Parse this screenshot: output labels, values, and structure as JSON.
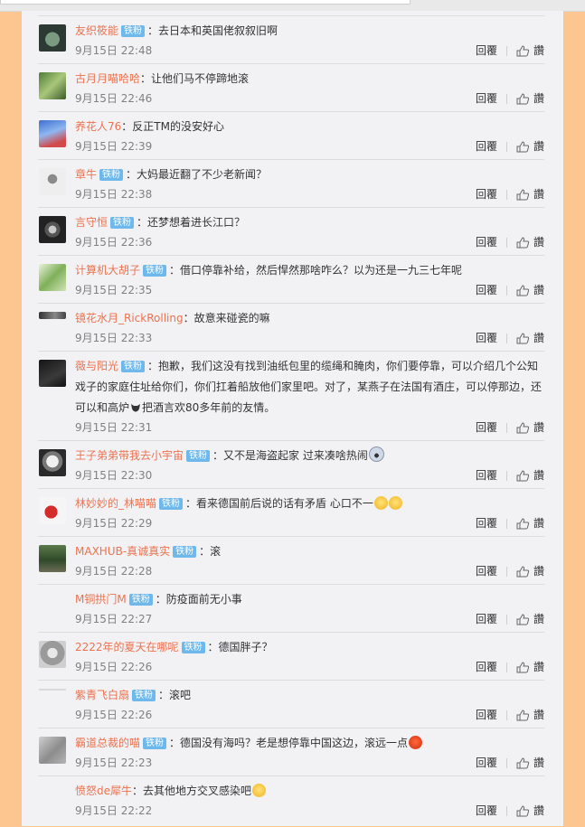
{
  "colors": {
    "background": "#fdc590",
    "panel": "#f2f2f5",
    "username": "#eb7350",
    "badge": "#6fb8ec",
    "time": "#808080"
  },
  "actions": {
    "reply_label": "回覆",
    "like_label": "讚"
  },
  "comments": [
    {
      "user": "友织筱能",
      "badge": "铁粉",
      "text": "：去日本和英国佬叙叙旧啊",
      "time": "9月15日 22:48"
    },
    {
      "user": "古月月喵哈哈",
      "badge": "",
      "text": "：让他们马不停蹄地滚",
      "time": "9月15日 22:46"
    },
    {
      "user": "养花人76",
      "badge": "",
      "text": "：反正TM的没安好心",
      "time": "9月15日 22:39"
    },
    {
      "user": "章牛",
      "badge": "铁粉",
      "text": "：大妈最近翻了不少老新闻？",
      "time": "9月15日 22:38"
    },
    {
      "user": "言守恒",
      "badge": "铁粉",
      "text": "：还梦想着进长江口？",
      "time": "9月15日 22:36"
    },
    {
      "user": "计算机大胡子",
      "badge": "铁粉",
      "text": "：借口停靠补给，然后悍然那啥咋么？以为还是一九三七年呢",
      "time": "9月15日 22:35"
    },
    {
      "user": "镜花水月_RickRolling",
      "badge": "",
      "text": "：故意来碰瓷的嘛",
      "time": "9月15日 22:33"
    },
    {
      "user": "薇与阳光",
      "badge": "铁粉",
      "text": "：抱歉，我们这没有找到油纸包里的缆绳和腌肉，你们要停靠，可以介绍几个公知戏子的家庭住址给你们，你们扛着船放他们家里吧。对了，某燕子在法国有酒庄，可以停那边，还可以和高炉",
      "text2": "把酒言欢80多年前的友情。",
      "time": "9月15日 22:31"
    },
    {
      "user": "王子弟弟带我去小宇宙",
      "badge": "铁粉",
      "text": "：又不是海盗起家 过来凑啥热闹",
      "time": "9月15日 22:30"
    },
    {
      "user": "林妙妙的_林喵喵",
      "badge": "铁粉",
      "text": "：看来德国前后说的话有矛盾 心口不一",
      "time": "9月15日 22:29"
    },
    {
      "user": "MAXHUB-真诚真实",
      "badge": "铁粉",
      "text": "：滚",
      "time": "9月15日 22:28"
    },
    {
      "user": "M铜拱门M",
      "badge": "铁粉",
      "text": "：防疫面前无小事",
      "time": "9月15日 22:27"
    },
    {
      "user": "2222年的夏天在哪呢",
      "badge": "铁粉",
      "text": "：德国胖子？",
      "time": "9月15日 22:26"
    },
    {
      "user": "紫青飞白扇",
      "badge": "铁粉",
      "text": "：滚吧",
      "time": "9月15日 22:26"
    },
    {
      "user": "霸道总裁的喵",
      "badge": "铁粉",
      "text": "：德国没有海吗？老是想停靠中国这边，滚远一点",
      "time": "9月15日 22:23"
    },
    {
      "user": "愤怒de犀牛",
      "badge": "",
      "text": "：去其他地方交叉感染吧",
      "time": "9月15日 22:22"
    }
  ]
}
